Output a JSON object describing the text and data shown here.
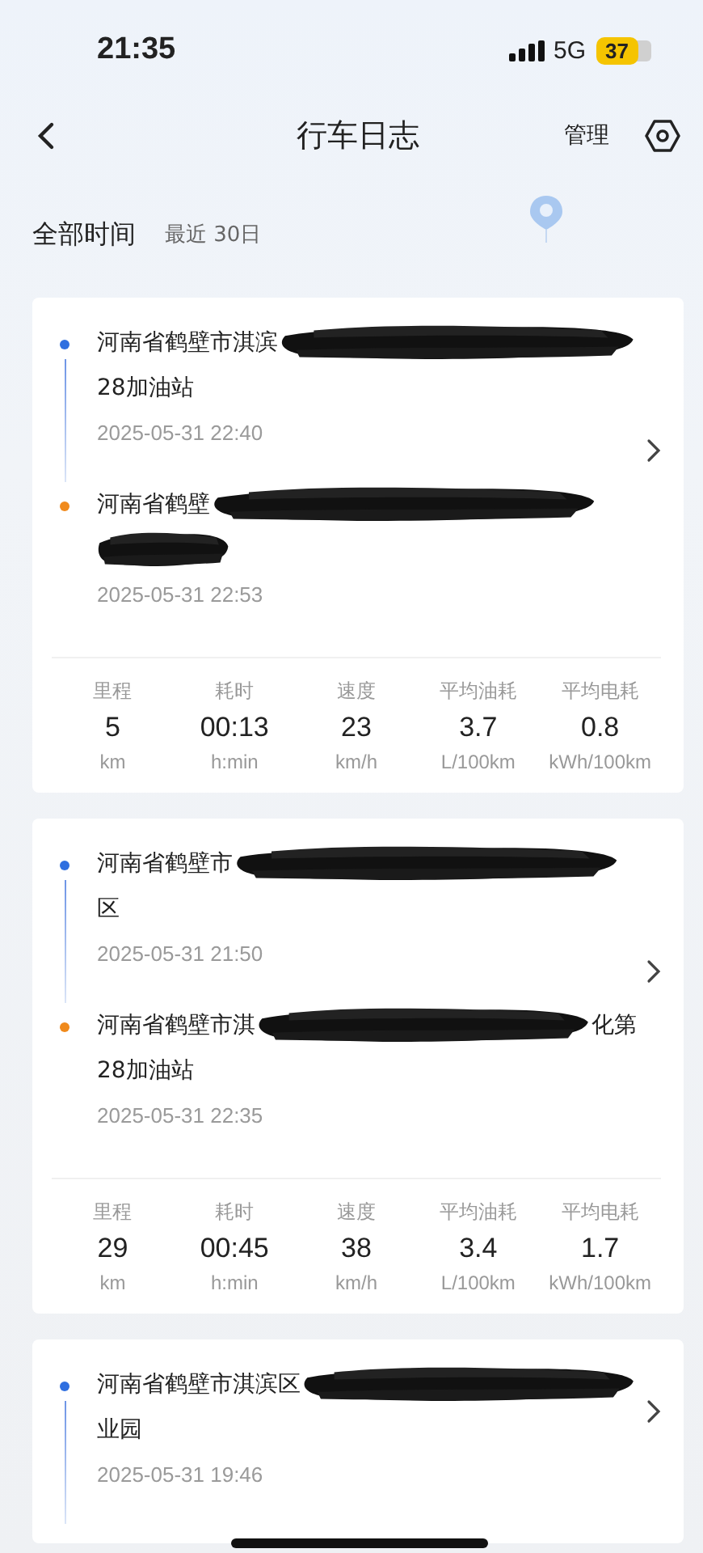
{
  "status_bar": {
    "time": "21:35",
    "network": "5G",
    "battery": "37"
  },
  "nav": {
    "title": "行车日志",
    "action": "管理"
  },
  "filter": {
    "label": "全部时间",
    "range": "最近 30日"
  },
  "trips": [
    {
      "stops": [
        {
          "color": "#2f6fe0",
          "lines": [
            [
              {
                "kind": "text",
                "text": "河南省鹤壁市淇滨"
              },
              {
                "kind": "redacted"
              }
            ],
            [
              {
                "kind": "text",
                "text": "28加油站"
              }
            ]
          ],
          "time": "2025-05-31 22:40"
        },
        {
          "color": "#f08a1c",
          "lines": [
            [
              {
                "kind": "text",
                "text": "河南省鹤壁"
              },
              {
                "kind": "redacted"
              }
            ],
            [
              {
                "kind": "redacted"
              }
            ]
          ],
          "time": "2025-05-31 22:53"
        }
      ],
      "stats": [
        {
          "label": "里程",
          "value": "5",
          "unit": "km"
        },
        {
          "label": "耗时",
          "value": "00:13",
          "unit": "h:min"
        },
        {
          "label": "速度",
          "value": "23",
          "unit": "km/h"
        },
        {
          "label": "平均油耗",
          "value": "3.7",
          "unit": "L/100km"
        },
        {
          "label": "平均电耗",
          "value": "0.8",
          "unit": "kWh/100km"
        }
      ]
    },
    {
      "stops": [
        {
          "color": "#2f6fe0",
          "lines": [
            [
              {
                "kind": "text",
                "text": "河南省鹤壁市"
              },
              {
                "kind": "redacted"
              }
            ],
            [
              {
                "kind": "text",
                "text": "区"
              }
            ]
          ],
          "time": "2025-05-31 21:50"
        },
        {
          "color": "#f08a1c",
          "lines": [
            [
              {
                "kind": "text",
                "text": "河南省鹤壁市淇"
              },
              {
                "kind": "redacted"
              },
              {
                "kind": "text",
                "text": "化第"
              }
            ],
            [
              {
                "kind": "text",
                "text": "28加油站"
              }
            ]
          ],
          "time": "2025-05-31 22:35"
        }
      ],
      "stats": [
        {
          "label": "里程",
          "value": "29",
          "unit": "km"
        },
        {
          "label": "耗时",
          "value": "00:45",
          "unit": "h:min"
        },
        {
          "label": "速度",
          "value": "38",
          "unit": "km/h"
        },
        {
          "label": "平均油耗",
          "value": "3.4",
          "unit": "L/100km"
        },
        {
          "label": "平均电耗",
          "value": "1.7",
          "unit": "kWh/100km"
        }
      ]
    },
    {
      "stops": [
        {
          "color": "#2f6fe0",
          "lines": [
            [
              {
                "kind": "text",
                "text": "河南省鹤壁市淇滨区"
              },
              {
                "kind": "redacted"
              }
            ],
            [
              {
                "kind": "text",
                "text": "业园"
              }
            ]
          ],
          "time": "2025-05-31 19:46"
        }
      ]
    }
  ]
}
